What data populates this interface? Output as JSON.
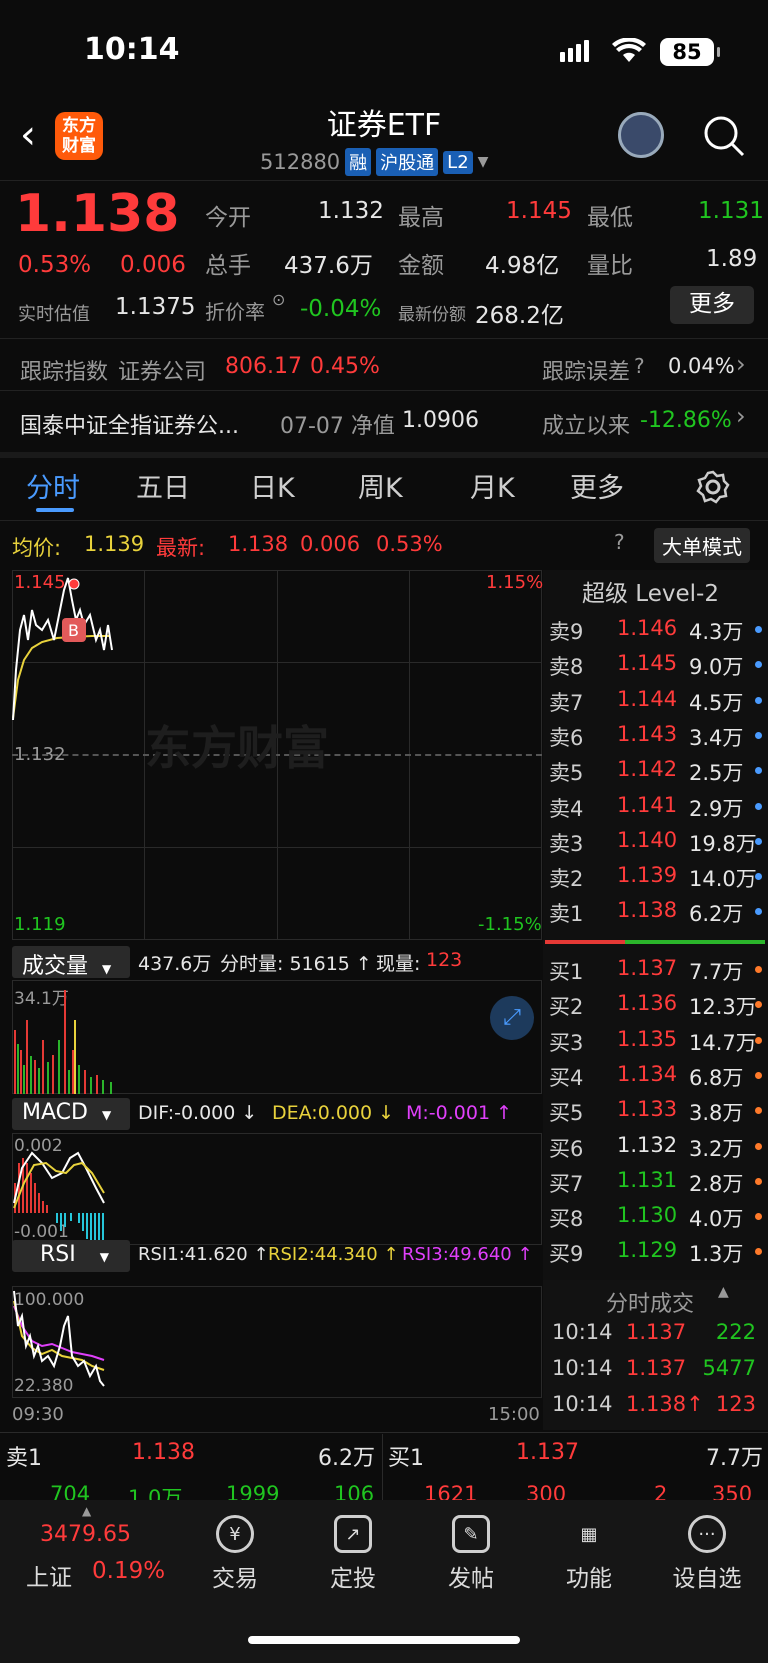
{
  "status": {
    "time": "10:14",
    "battery": "85"
  },
  "header": {
    "title": "证券ETF",
    "code": "512880",
    "tags": [
      "融",
      "沪股通",
      "L2"
    ],
    "logo": "东方财富"
  },
  "quote": {
    "price": "1.138",
    "pct": "0.53%",
    "chg": "0.006",
    "est_label": "实时估值",
    "est": "1.1375",
    "open_l": "今开",
    "open": "1.132",
    "high_l": "最高",
    "high": "1.145",
    "low_l": "最低",
    "low": "1.131",
    "vol_l": "总手",
    "vol": "437.6万",
    "amt_l": "金额",
    "amt": "4.98亿",
    "ratio_l": "量比",
    "ratio": "1.89",
    "prem_l": "折价率",
    "prem": "-0.04%",
    "share_l": "最新份额",
    "share": "268.2亿",
    "more": "更多"
  },
  "track": {
    "l": "跟踪指数",
    "name": "证券公司",
    "val": "806.17",
    "pct": "0.45%",
    "err_l": "跟踪误差",
    "err": "0.04%"
  },
  "fund": {
    "name": "国泰中证全指证券公...",
    "date": "07-07 净值",
    "nav": "1.0906",
    "since_l": "成立以来",
    "since": "-12.86%"
  },
  "tabs": [
    "分时",
    "五日",
    "日K",
    "周K",
    "月K",
    "更多"
  ],
  "chartinfo": {
    "avg_l": "均价:",
    "avg": "1.139",
    "last_l": "最新:",
    "last": "1.138",
    "chg": "0.006",
    "pct": "0.53%",
    "mode": "大单模式"
  },
  "chart": {
    "hi": "1.145",
    "mid": "1.132",
    "lo": "1.119",
    "hip": "1.15%",
    "lop": "-1.15%",
    "wm": "东方财富",
    "t0": "09:30",
    "t1": "15:00"
  },
  "volbar": {
    "l": "成交量",
    "total": "437.6万",
    "fs": "分时量: 51615 ↑",
    "now_l": "现量:",
    "now": "123",
    "max": "34.1万"
  },
  "macd": {
    "l": "MACD",
    "dif": "DIF:-0.000 ↓",
    "dea": "DEA:0.000 ↓",
    "m": "M:-0.001 ↑",
    "top": "0.002",
    "bot": "-0.001"
  },
  "rsi": {
    "l": "RSI",
    "r1": "RSI1:41.620 ↑",
    "r2": "RSI2:44.340 ↑",
    "r3": "RSI3:49.640 ↑",
    "top": "100.000",
    "bot": "22.380"
  },
  "orderbook": {
    "title": "超级 Level-2",
    "asks": [
      [
        "卖9",
        "1.146",
        "4.3万"
      ],
      [
        "卖8",
        "1.145",
        "9.0万"
      ],
      [
        "卖7",
        "1.144",
        "4.5万"
      ],
      [
        "卖6",
        "1.143",
        "3.4万"
      ],
      [
        "卖5",
        "1.142",
        "2.5万"
      ],
      [
        "卖4",
        "1.141",
        "2.9万"
      ],
      [
        "卖3",
        "1.140",
        "19.8万"
      ],
      [
        "卖2",
        "1.139",
        "14.0万"
      ],
      [
        "卖1",
        "1.138",
        "6.2万"
      ]
    ],
    "bids": [
      [
        "买1",
        "1.137",
        "7.7万"
      ],
      [
        "买2",
        "1.136",
        "12.3万"
      ],
      [
        "买3",
        "1.135",
        "14.7万"
      ],
      [
        "买4",
        "1.134",
        "6.8万"
      ],
      [
        "买5",
        "1.133",
        "3.8万"
      ],
      [
        "买6",
        "1.132",
        "3.2万"
      ],
      [
        "买7",
        "1.131",
        "2.8万"
      ],
      [
        "买8",
        "1.130",
        "4.0万"
      ],
      [
        "买9",
        "1.129",
        "1.3万"
      ]
    ]
  },
  "ticks": {
    "title": "分时成交",
    "rows": [
      [
        "10:14",
        "1.137",
        "222"
      ],
      [
        "10:14",
        "1.137",
        "5477"
      ],
      [
        "10:14",
        "1.138↑",
        "123"
      ]
    ]
  },
  "bar1": {
    "s_l": "卖1",
    "s_p": "1.138",
    "s_v": "6.2万",
    "b_l": "买1",
    "b_p": "1.137",
    "b_v": "7.7万",
    "n": [
      "704",
      "1.0万",
      "1999",
      "106",
      "1621",
      "300",
      "2",
      "350"
    ]
  },
  "bottom": {
    "idx": "3479.65",
    "idx_l": "上证",
    "idx_p": "0.19%",
    "nav": [
      "交易",
      "定投",
      "发帖",
      "功能",
      "设自选"
    ]
  }
}
